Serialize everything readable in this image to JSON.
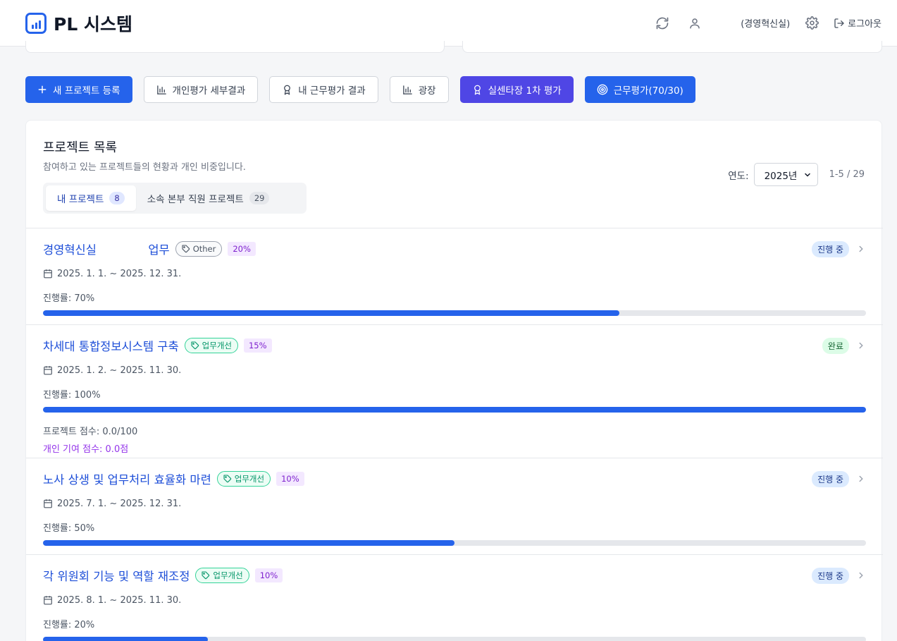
{
  "header": {
    "app_title": "PL 시스템",
    "department": "(경영혁신실)",
    "logout_label": "로그아웃"
  },
  "actions": {
    "new_project": "새 프로젝트 등록",
    "personal_eval": "개인평가 세부결과",
    "my_work_eval": "내 근무평가 결과",
    "plaza": "광장",
    "director_eval": "실센타장 1차 평가",
    "work_eval": "근무평가(70/30)"
  },
  "project_list": {
    "title": "프로젝트 목록",
    "subtitle": "참여하고 있는 프로젝트들의 현황과 개인 비중입니다.",
    "tabs": [
      {
        "label": "내 프로젝트",
        "count": "8"
      },
      {
        "label": "소속 본부 직원 프로젝트",
        "count": "29"
      }
    ],
    "year_label": "연도:",
    "year_value": "2025년",
    "range": "1-5 / 29",
    "items": [
      {
        "name": "경영혁신실              업무",
        "tag": "Other",
        "share": "20%",
        "status": "진행 중",
        "dates": "2025. 1. 1. ~ 2025. 12. 31.",
        "progress_label": "진행률: 70%",
        "progress": 0.7
      },
      {
        "name": "차세대 통합정보시스템 구축",
        "tag": "업무개선",
        "share": "15%",
        "status": "완료",
        "dates": "2025. 1. 2. ~ 2025. 11. 30.",
        "progress_label": "진행률: 100%",
        "progress": 1.0,
        "score": "프로젝트 점수: 0.0/100",
        "contribution": "개인 기여 점수: 0.0점"
      },
      {
        "name": "노사 상생 및 업무처리 효율화 마련",
        "tag": "업무개선",
        "share": "10%",
        "status": "진행 중",
        "dates": "2025. 7. 1. ~ 2025. 12. 31.",
        "progress_label": "진행률: 50%",
        "progress": 0.5
      },
      {
        "name": "각 위원회 기능 및 역할 재조정",
        "tag": "업무개선",
        "share": "10%",
        "status": "진행 중",
        "dates": "2025. 8. 1. ~ 2025. 11. 30.",
        "progress_label": "진행률: 20%",
        "progress": 0.2
      }
    ]
  }
}
